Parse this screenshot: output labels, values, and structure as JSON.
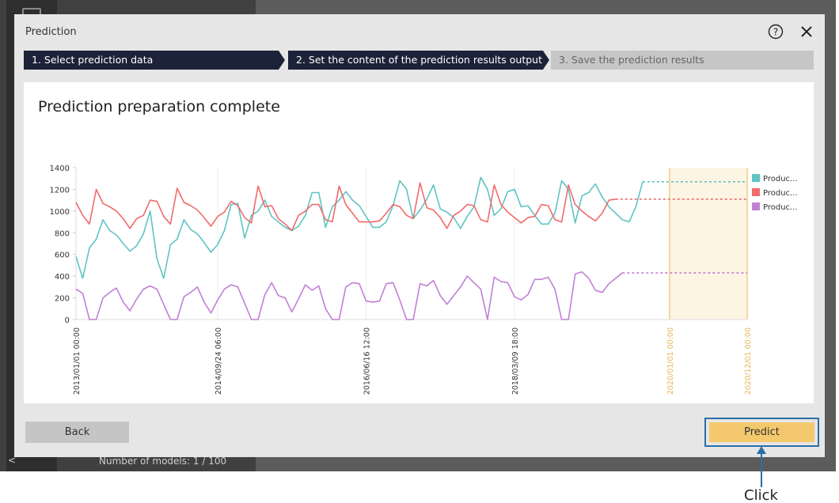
{
  "background": {
    "models_text": "Number of models: 1 / 100",
    "back_arrow": "<"
  },
  "dialog": {
    "title": "Prediction",
    "steps": [
      {
        "label": "1. Select prediction data",
        "state": "done"
      },
      {
        "label": "2. Set the content of the prediction results output",
        "state": "active"
      },
      {
        "label": "3. Save the prediction results",
        "state": "inactive"
      }
    ],
    "panel_title": "Prediction preparation complete",
    "back_label": "Back",
    "predict_label": "Predict"
  },
  "annotation": {
    "click_label": "Click",
    "color": "#2b6fa7"
  },
  "colors": {
    "series_teal": "#5ec4c4",
    "series_red": "#f26a6a",
    "series_purple": "#c17fd6",
    "forecast_band": "#fdf5e4",
    "forecast_line": "#f1d99e"
  },
  "chart_data": {
    "type": "line",
    "ylim": [
      0,
      1400
    ],
    "yticks": [
      0,
      200,
      400,
      600,
      800,
      1000,
      1200,
      1400
    ],
    "xtick_labels": [
      {
        "label": "2013/01/01 00:00",
        "index": 0,
        "forecast": false
      },
      {
        "label": "2014/09/24 06:00",
        "index": 21,
        "forecast": false
      },
      {
        "label": "2016/06/16 12:00",
        "index": 43,
        "forecast": false
      },
      {
        "label": "2018/03/09 18:00",
        "index": 65,
        "forecast": false
      },
      {
        "label": "2020/01/01 00:00",
        "index": 88,
        "forecast": true
      },
      {
        "label": "2020/12/01 00:00",
        "index": 99.5,
        "forecast": true
      }
    ],
    "history_points": 88,
    "forecast_start_index": 88,
    "forecast_end_index": 99.5,
    "series": [
      {
        "name": "Produc...",
        "color": "#5ec4c4",
        "values": [
          580,
          380,
          660,
          740,
          920,
          820,
          780,
          700,
          630,
          680,
          790,
          1000,
          560,
          380,
          690,
          740,
          920,
          830,
          790,
          710,
          620,
          690,
          820,
          1060,
          1070,
          750,
          960,
          1000,
          1100,
          950,
          900,
          850,
          820,
          860,
          960,
          1170,
          1170,
          850,
          1040,
          1100,
          1180,
          1100,
          1050,
          950,
          850,
          850,
          900,
          1050,
          1280,
          1200,
          930,
          1010,
          1110,
          1240,
          1020,
          990,
          940,
          840,
          950,
          1040,
          1310,
          1200,
          960,
          1020,
          1180,
          1200,
          1040,
          1050,
          960,
          880,
          880,
          980,
          1280,
          1200,
          890,
          1140,
          1170,
          1250,
          1130,
          1040,
          980,
          920,
          900,
          1040,
          1270
        ],
        "forecast_value": 1270
      },
      {
        "name": "Produc...",
        "color": "#f26a6a",
        "values": [
          1080,
          960,
          880,
          1200,
          1070,
          1040,
          1000,
          930,
          840,
          930,
          960,
          1100,
          1090,
          950,
          880,
          1210,
          1080,
          1050,
          1010,
          940,
          860,
          950,
          990,
          1090,
          1050,
          940,
          890,
          1230,
          1040,
          1050,
          930,
          880,
          820,
          960,
          1000,
          1060,
          1060,
          920,
          900,
          1230,
          1060,
          980,
          900,
          900,
          900,
          910,
          980,
          1060,
          1040,
          960,
          930,
          1260,
          1030,
          1010,
          940,
          840,
          960,
          1000,
          1060,
          1050,
          920,
          900,
          1240,
          1060,
          990,
          940,
          890,
          940,
          950,
          1060,
          1050,
          920,
          900,
          1240,
          1060,
          1000,
          950,
          910,
          980,
          1100,
          1110
        ],
        "forecast_value": 1110
      },
      {
        "name": "Produc...",
        "color": "#c17fd6",
        "values": [
          280,
          240,
          0,
          0,
          200,
          250,
          290,
          160,
          80,
          190,
          280,
          310,
          280,
          140,
          0,
          0,
          210,
          250,
          300,
          160,
          60,
          180,
          280,
          320,
          300,
          150,
          0,
          0,
          230,
          340,
          220,
          200,
          70,
          190,
          320,
          270,
          310,
          100,
          0,
          0,
          300,
          340,
          330,
          170,
          160,
          170,
          330,
          340,
          180,
          0,
          0,
          330,
          310,
          360,
          220,
          140,
          220,
          300,
          400,
          340,
          280,
          0,
          390,
          350,
          340,
          210,
          180,
          230,
          370,
          370,
          390,
          280,
          0,
          0,
          420,
          440,
          380,
          270,
          250,
          330,
          380,
          430
        ],
        "forecast_value": 430
      }
    ],
    "legend": "right"
  }
}
